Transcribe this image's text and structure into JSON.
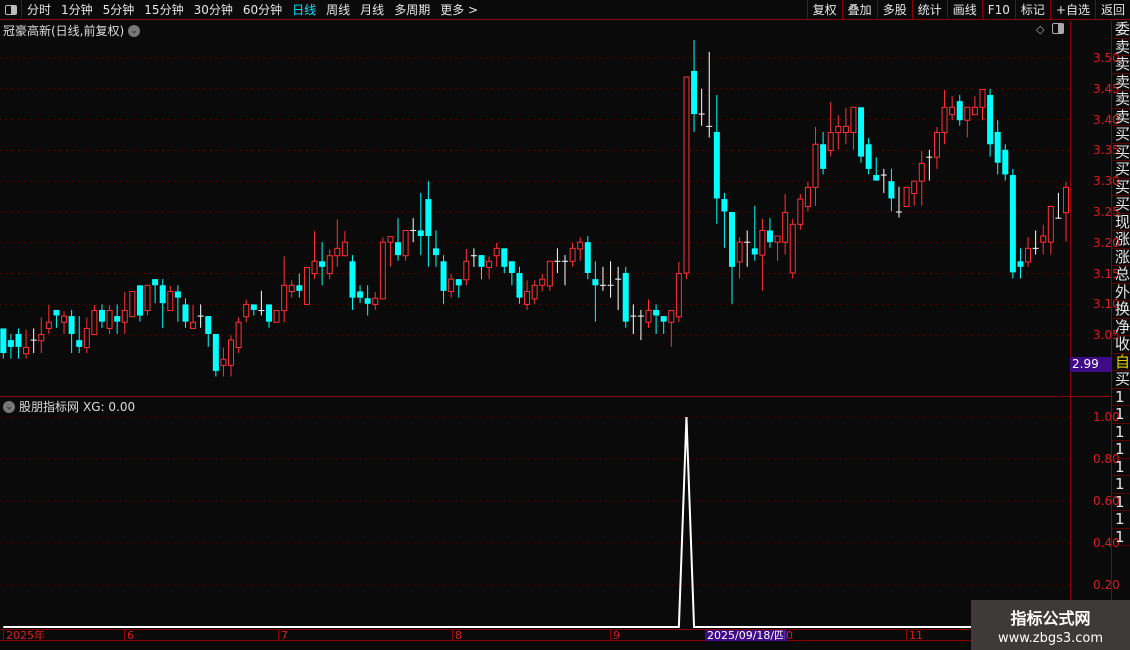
{
  "toolbar": {
    "left_items": [
      "分时",
      "1分钟",
      "5分钟",
      "15分钟",
      "30分钟",
      "60分钟",
      "日线",
      "周线",
      "月线",
      "多周期",
      "更多 >"
    ],
    "active_index": 6,
    "right_items": [
      "复权",
      "叠加",
      "多股",
      "统计",
      "画线",
      "F10",
      "标记",
      "+自选",
      "返回"
    ]
  },
  "main_chart": {
    "title": "冠豪高新(日线,前复权)",
    "price_ticks": [
      "3.50",
      "3.45",
      "3.40",
      "3.35",
      "3.30",
      "3.25",
      "3.20",
      "3.15",
      "3.10",
      "3.05"
    ],
    "low_tag": "2.99",
    "colors": {
      "up": "#ff3232",
      "down": "#00ffff",
      "flat": "#ffffff",
      "grid": "#6b0000"
    }
  },
  "chart_data": {
    "type": "candlestick",
    "ylim": [
      3.0,
      3.53
    ],
    "ohlc": [
      [
        3.061,
        3.061,
        3.012,
        3.021
      ],
      [
        3.042,
        3.052,
        3.012,
        3.031
      ],
      [
        3.052,
        3.061,
        3.012,
        3.031
      ],
      [
        3.02,
        3.059,
        3.012,
        3.03
      ],
      [
        3.042,
        3.061,
        3.021,
        3.042
      ],
      [
        3.041,
        3.079,
        3.021,
        3.051
      ],
      [
        3.061,
        3.099,
        3.052,
        3.071
      ],
      [
        3.091,
        3.091,
        3.062,
        3.082
      ],
      [
        3.071,
        3.089,
        3.052,
        3.081
      ],
      [
        3.081,
        3.091,
        3.021,
        3.052
      ],
      [
        3.042,
        3.081,
        3.021,
        3.031
      ],
      [
        3.03,
        3.079,
        3.021,
        3.061
      ],
      [
        3.051,
        3.099,
        3.051,
        3.09
      ],
      [
        3.091,
        3.1,
        3.062,
        3.072
      ],
      [
        3.061,
        3.099,
        3.052,
        3.09
      ],
      [
        3.081,
        3.1,
        3.052,
        3.072
      ],
      [
        3.071,
        3.12,
        3.052,
        3.09
      ],
      [
        3.08,
        3.121,
        3.08,
        3.121
      ],
      [
        3.131,
        3.131,
        3.072,
        3.082
      ],
      [
        3.09,
        3.131,
        3.082,
        3.131
      ],
      [
        3.141,
        3.141,
        3.102,
        3.131
      ],
      [
        3.131,
        3.141,
        3.062,
        3.102
      ],
      [
        3.09,
        3.13,
        3.09,
        3.121
      ],
      [
        3.121,
        3.131,
        3.072,
        3.111
      ],
      [
        3.1,
        3.11,
        3.062,
        3.072
      ],
      [
        3.061,
        3.099,
        3.061,
        3.071
      ],
      [
        3.081,
        3.1,
        3.062,
        3.081
      ],
      [
        3.081,
        3.081,
        3.031,
        3.052
      ],
      [
        3.052,
        3.052,
        2.983,
        2.992
      ],
      [
        3.001,
        3.03,
        2.983,
        3.011
      ],
      [
        3.001,
        3.05,
        2.983,
        3.042
      ],
      [
        3.03,
        3.079,
        3.021,
        3.071
      ],
      [
        3.08,
        3.108,
        3.071,
        3.1
      ],
      [
        3.1,
        3.1,
        3.082,
        3.091
      ],
      [
        3.09,
        3.122,
        3.082,
        3.09
      ],
      [
        3.1,
        3.1,
        3.062,
        3.072
      ],
      [
        3.071,
        3.09,
        3.071,
        3.09
      ],
      [
        3.09,
        3.178,
        3.071,
        3.131
      ],
      [
        3.121,
        3.139,
        3.111,
        3.131
      ],
      [
        3.131,
        3.15,
        3.111,
        3.122
      ],
      [
        3.1,
        3.16,
        3.1,
        3.16
      ],
      [
        3.15,
        3.219,
        3.141,
        3.17
      ],
      [
        3.17,
        3.201,
        3.131,
        3.161
      ],
      [
        3.15,
        3.189,
        3.141,
        3.179
      ],
      [
        3.179,
        3.238,
        3.161,
        3.191
      ],
      [
        3.179,
        3.219,
        3.179,
        3.201
      ],
      [
        3.17,
        3.18,
        3.091,
        3.111
      ],
      [
        3.121,
        3.131,
        3.102,
        3.111
      ],
      [
        3.11,
        3.131,
        3.082,
        3.101
      ],
      [
        3.1,
        3.12,
        3.091,
        3.11
      ],
      [
        3.109,
        3.209,
        3.109,
        3.201
      ],
      [
        3.201,
        3.21,
        3.161,
        3.21
      ],
      [
        3.201,
        3.24,
        3.171,
        3.18
      ],
      [
        3.179,
        3.22,
        3.171,
        3.22
      ],
      [
        3.22,
        3.24,
        3.201,
        3.22
      ],
      [
        3.22,
        3.281,
        3.18,
        3.211
      ],
      [
        3.271,
        3.3,
        3.161,
        3.211
      ],
      [
        3.191,
        3.22,
        3.161,
        3.18
      ],
      [
        3.17,
        3.18,
        3.101,
        3.122
      ],
      [
        3.121,
        3.149,
        3.111,
        3.141
      ],
      [
        3.141,
        3.141,
        3.111,
        3.131
      ],
      [
        3.14,
        3.19,
        3.131,
        3.17
      ],
      [
        3.179,
        3.191,
        3.161,
        3.179
      ],
      [
        3.18,
        3.18,
        3.141,
        3.161
      ],
      [
        3.16,
        3.178,
        3.141,
        3.17
      ],
      [
        3.179,
        3.2,
        3.161,
        3.191
      ],
      [
        3.191,
        3.191,
        3.151,
        3.161
      ],
      [
        3.17,
        3.17,
        3.131,
        3.151
      ],
      [
        3.151,
        3.161,
        3.101,
        3.111
      ],
      [
        3.1,
        3.139,
        3.091,
        3.121
      ],
      [
        3.109,
        3.139,
        3.101,
        3.131
      ],
      [
        3.131,
        3.149,
        3.122,
        3.141
      ],
      [
        3.13,
        3.17,
        3.122,
        3.17
      ],
      [
        3.17,
        3.191,
        3.151,
        3.17
      ],
      [
        3.17,
        3.18,
        3.131,
        3.17
      ],
      [
        3.17,
        3.2,
        3.161,
        3.191
      ],
      [
        3.19,
        3.209,
        3.171,
        3.201
      ],
      [
        3.201,
        3.211,
        3.141,
        3.151
      ],
      [
        3.141,
        3.17,
        3.072,
        3.131
      ],
      [
        3.131,
        3.161,
        3.122,
        3.131
      ],
      [
        3.131,
        3.17,
        3.111,
        3.131
      ],
      [
        3.141,
        3.161,
        3.091,
        3.141
      ],
      [
        3.151,
        3.161,
        3.062,
        3.072
      ],
      [
        3.081,
        3.1,
        3.052,
        3.081
      ],
      [
        3.081,
        3.091,
        3.042,
        3.081
      ],
      [
        3.071,
        3.108,
        3.062,
        3.09
      ],
      [
        3.091,
        3.1,
        3.052,
        3.082
      ],
      [
        3.081,
        3.081,
        3.052,
        3.072
      ],
      [
        3.071,
        3.09,
        3.031,
        3.09
      ],
      [
        3.08,
        3.169,
        3.071,
        3.15
      ],
      [
        3.151,
        3.469,
        3.141,
        3.469
      ],
      [
        3.479,
        3.529,
        3.38,
        3.409
      ],
      [
        3.409,
        3.45,
        3.39,
        3.409
      ],
      [
        3.389,
        3.51,
        3.371,
        3.389
      ],
      [
        3.38,
        3.44,
        3.231,
        3.272
      ],
      [
        3.271,
        3.281,
        3.192,
        3.251
      ],
      [
        3.25,
        3.25,
        3.101,
        3.161
      ],
      [
        3.169,
        3.209,
        3.142,
        3.201
      ],
      [
        3.201,
        3.22,
        3.161,
        3.201
      ],
      [
        3.191,
        3.26,
        3.171,
        3.181
      ],
      [
        3.18,
        3.239,
        3.122,
        3.22
      ],
      [
        3.22,
        3.24,
        3.192,
        3.201
      ],
      [
        3.201,
        3.211,
        3.171,
        3.211
      ],
      [
        3.201,
        3.279,
        3.181,
        3.249
      ],
      [
        3.151,
        3.239,
        3.142,
        3.23
      ],
      [
        3.23,
        3.279,
        3.221,
        3.271
      ],
      [
        3.259,
        3.299,
        3.251,
        3.29
      ],
      [
        3.29,
        3.388,
        3.26,
        3.36
      ],
      [
        3.36,
        3.38,
        3.311,
        3.32
      ],
      [
        3.35,
        3.429,
        3.34,
        3.379
      ],
      [
        3.379,
        3.407,
        3.351,
        3.389
      ],
      [
        3.379,
        3.419,
        3.36,
        3.389
      ],
      [
        3.379,
        3.42,
        3.351,
        3.42
      ],
      [
        3.42,
        3.42,
        3.33,
        3.34
      ],
      [
        3.36,
        3.37,
        3.311,
        3.32
      ],
      [
        3.31,
        3.339,
        3.301,
        3.301
      ],
      [
        3.31,
        3.32,
        3.281,
        3.31
      ],
      [
        3.3,
        3.32,
        3.251,
        3.272
      ],
      [
        3.25,
        3.291,
        3.241,
        3.25
      ],
      [
        3.259,
        3.29,
        3.259,
        3.29
      ],
      [
        3.28,
        3.3,
        3.26,
        3.3
      ],
      [
        3.3,
        3.349,
        3.26,
        3.329
      ],
      [
        3.339,
        3.351,
        3.301,
        3.339
      ],
      [
        3.339,
        3.388,
        3.32,
        3.379
      ],
      [
        3.379,
        3.448,
        3.36,
        3.42
      ],
      [
        3.408,
        3.438,
        3.399,
        3.42
      ],
      [
        3.43,
        3.44,
        3.39,
        3.399
      ],
      [
        3.399,
        3.42,
        3.371,
        3.42
      ],
      [
        3.408,
        3.438,
        3.408,
        3.42
      ],
      [
        3.42,
        3.449,
        3.399,
        3.449
      ],
      [
        3.44,
        3.45,
        3.34,
        3.36
      ],
      [
        3.38,
        3.399,
        3.311,
        3.33
      ],
      [
        3.351,
        3.36,
        3.301,
        3.311
      ],
      [
        3.31,
        3.32,
        3.142,
        3.152
      ],
      [
        3.17,
        3.191,
        3.142,
        3.161
      ],
      [
        3.169,
        3.209,
        3.161,
        3.191
      ],
      [
        3.191,
        3.22,
        3.181,
        3.191
      ],
      [
        3.201,
        3.229,
        3.181,
        3.211
      ],
      [
        3.201,
        3.259,
        3.181,
        3.259
      ],
      [
        3.24,
        3.281,
        3.24,
        3.24
      ],
      [
        3.249,
        3.299,
        3.202,
        3.29
      ]
    ]
  },
  "indicator": {
    "title": "股朋指标网",
    "readout": "XG: 0.00",
    "ticks": [
      "1.00",
      "0.80",
      "0.60",
      "0.40",
      "0.20"
    ],
    "ylim": [
      0,
      1.05
    ],
    "signal_index": 90,
    "line_color": "#ffffff"
  },
  "time_axis": {
    "labels": [
      "2025年",
      "6",
      "7",
      "8",
      "9",
      "0",
      "11"
    ],
    "selected_date": "2025/09/18/四"
  },
  "right_strip": [
    "委",
    "卖",
    "卖",
    "卖",
    "卖",
    "卖",
    "买",
    "买",
    "买",
    "买",
    "买",
    "现",
    "涨",
    "涨",
    "总",
    "外",
    "换",
    "净",
    "收",
    "自",
    "买",
    "1",
    "1",
    "1",
    "1",
    "1",
    "1",
    "1",
    "1",
    "1"
  ],
  "watermark": {
    "line1": "指标公式网",
    "line2": "www.zbgs3.com"
  }
}
